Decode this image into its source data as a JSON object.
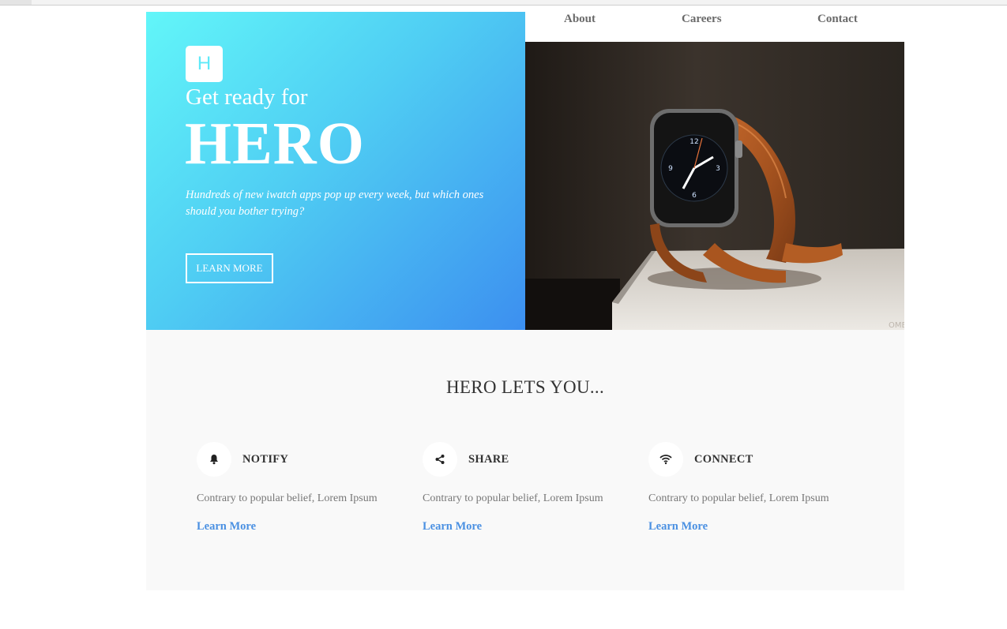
{
  "nav": {
    "items": [
      "About",
      "Careers",
      "Contact"
    ]
  },
  "hero": {
    "logo_letter": "H",
    "kicker": "Get ready for",
    "title": "HERO",
    "description": "Hundreds of new iwatch apps pop up every week, but which ones should you bother trying?",
    "button_label": "LEARN MORE"
  },
  "features": {
    "heading": "HERO LETS YOU...",
    "items": [
      {
        "icon": "bell-icon",
        "title": "NOTIFY",
        "text": "Contrary to popular belief, Lorem Ipsum",
        "link": "Learn More"
      },
      {
        "icon": "share-icon",
        "title": "SHARE",
        "text": "Contrary to popular belief, Lorem Ipsum",
        "link": "Learn More"
      },
      {
        "icon": "wifi-icon",
        "title": "CONNECT",
        "text": "Contrary to popular belief, Lorem Ipsum",
        "link": "Learn More"
      }
    ]
  },
  "colors": {
    "gradient_start": "#62f6f9",
    "gradient_end": "#3c8ff0",
    "link": "#4a90e2",
    "features_bg": "#f9f9f9"
  }
}
